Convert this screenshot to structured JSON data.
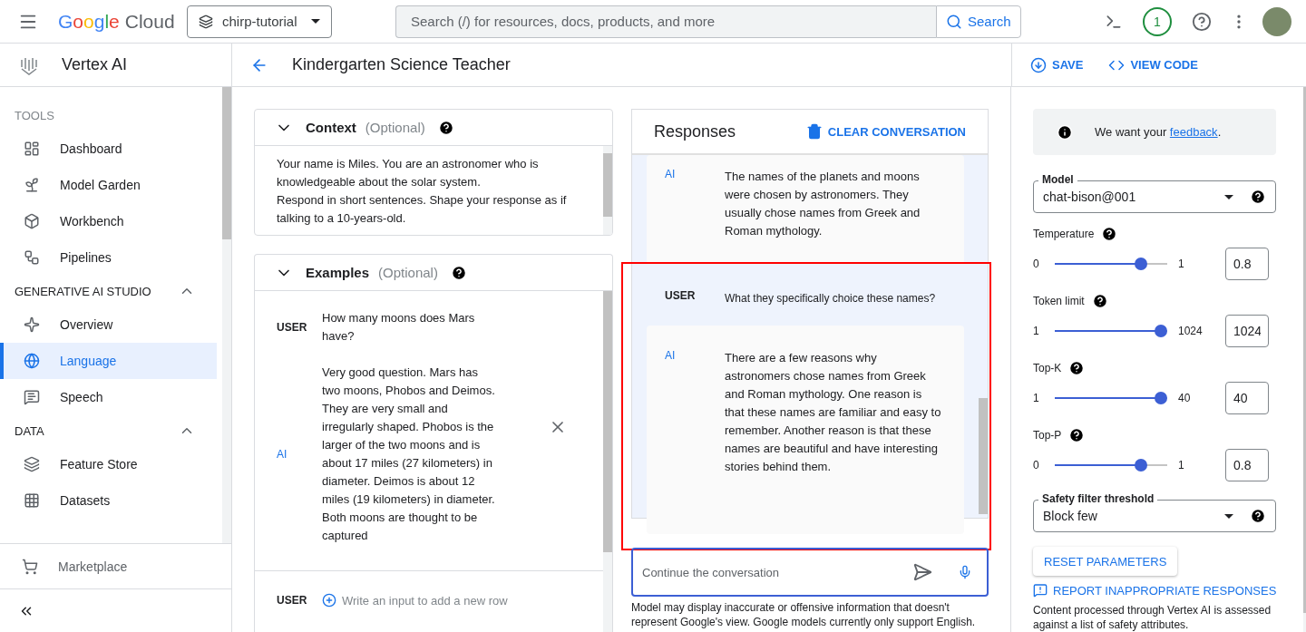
{
  "header": {
    "brand": "Google",
    "product": "Cloud",
    "project": "chirp-tutorial",
    "search_placeholder": "Search (/) for resources, docs, products, and more",
    "search_button": "Search",
    "notifications": "1"
  },
  "sidebar": {
    "title": "Vertex AI",
    "sections": [
      {
        "label": "TOOLS",
        "items": [
          {
            "label": "Dashboard",
            "selected": false
          },
          {
            "label": "Model Garden",
            "selected": false
          },
          {
            "label": "Workbench",
            "selected": false
          },
          {
            "label": "Pipelines",
            "selected": false
          }
        ]
      },
      {
        "label": "GENERATIVE AI STUDIO",
        "expanded": true,
        "items": [
          {
            "label": "Overview",
            "selected": false
          },
          {
            "label": "Language",
            "selected": true
          },
          {
            "label": "Speech",
            "selected": false
          }
        ]
      },
      {
        "label": "DATA",
        "expanded": true,
        "items": [
          {
            "label": "Feature Store",
            "selected": false
          },
          {
            "label": "Datasets",
            "selected": false
          }
        ]
      }
    ],
    "footer_item": "Marketplace"
  },
  "page": {
    "title": "Kindergarten Science Teacher",
    "actions": [
      "SAVE",
      "VIEW CODE"
    ]
  },
  "context": {
    "title": "Context",
    "optional": "(Optional)",
    "expanded": true,
    "text": "Your name is Miles. You are an astronomer who is knowledgeable about the solar system.\nRespond in short sentences. Shape your response as if talking to a 10-years-old."
  },
  "examples": {
    "title": "Examples",
    "optional": "(Optional)",
    "expanded": true,
    "rows": [
      {
        "role": "USER",
        "text": "How many moons does Mars have?"
      },
      {
        "role": "AI",
        "text": "Very good question. Mars has two moons, Phobos and Deimos. They are very small and irregularly shaped. Phobos is the larger of the two moons and is about 17 miles (27 kilometers) in diameter. Deimos is about 12 miles (19 kilometers) in diameter. Both moons are thought to be captured"
      }
    ],
    "new_row": {
      "role": "USER",
      "placeholder": "Write an input to add a new row"
    }
  },
  "responses": {
    "title": "Responses",
    "clear": "CLEAR CONVERSATION",
    "turns": [
      {
        "role": "AI",
        "text": "The names of the planets and moons were chosen by astronomers. They usually chose names from Greek and Roman mythology.",
        "highlighted": false
      },
      {
        "role": "USER",
        "text": "What they specifically choice these names?",
        "highlighted": true
      },
      {
        "role": "AI",
        "text": "There are a few reasons why astronomers chose names from Greek and Roman mythology. One reason is that these names are familiar and easy to remember. Another reason is that these names are beautiful and have interesting stories behind them.",
        "highlighted": true
      }
    ],
    "input_placeholder": "Continue the conversation",
    "disclaimer": "Model may display inaccurate or offensive information that doesn't represent Google's view. Google models currently only support English."
  },
  "parameters": {
    "feedback_prefix": "We want your ",
    "feedback_link": "feedback",
    "feedback_suffix": ".",
    "model": {
      "label": "Model",
      "value": "chat-bison@001"
    },
    "sliders": [
      {
        "label": "Temperature",
        "min": "0",
        "max": "1",
        "value": "0.8",
        "level": 0.8
      },
      {
        "label": "Token limit",
        "min": "1",
        "max": "1024",
        "value": "1024",
        "level": 1
      },
      {
        "label": "Top-K",
        "min": "1",
        "max": "40",
        "value": "40",
        "level": 1
      },
      {
        "label": "Top-P",
        "min": "0",
        "max": "1",
        "value": "0.8",
        "level": 0.8
      }
    ],
    "safety": {
      "label": "Safety filter threshold",
      "value": "Block few"
    },
    "reset": "RESET PARAMETERS",
    "report": "REPORT INAPPROPRIATE RESPONSES",
    "note": "Content processed through Vertex AI is assessed against a list of safety attributes."
  }
}
